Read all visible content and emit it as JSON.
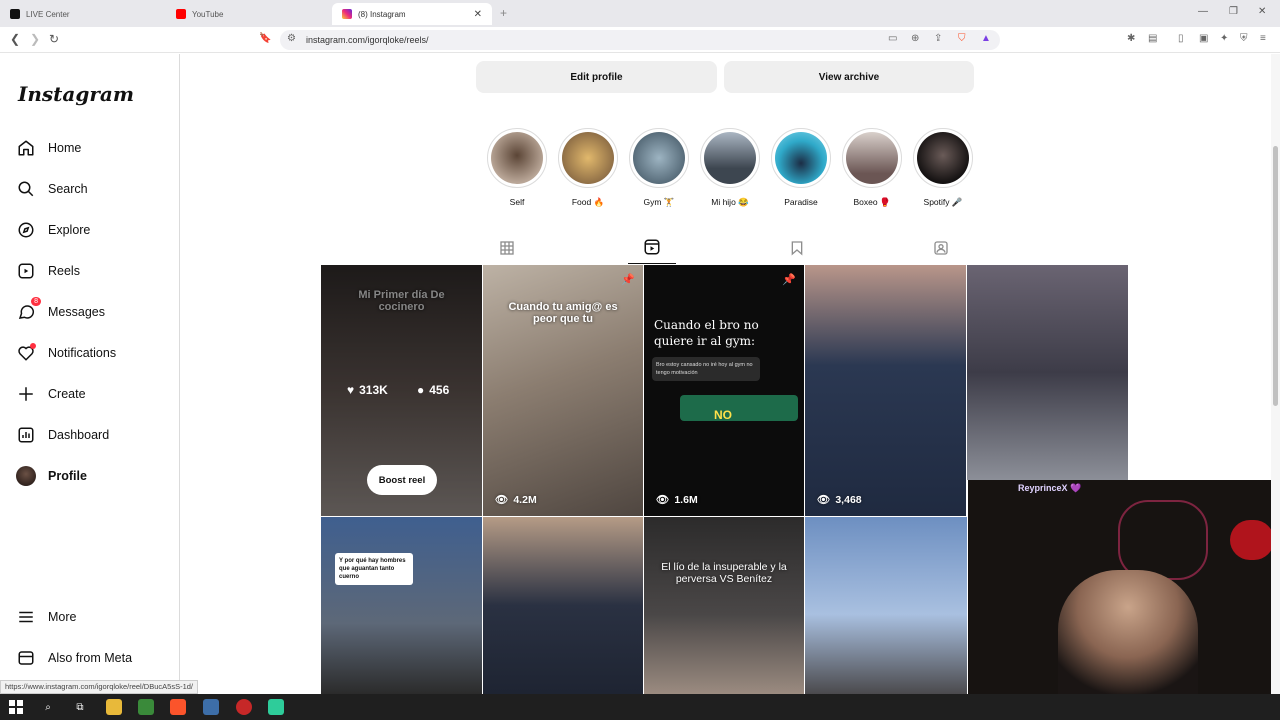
{
  "browser": {
    "tabs": [
      {
        "label": "LIVE Center",
        "icon": "tiktok-icon",
        "color": "#111111"
      },
      {
        "label": "YouTube",
        "icon": "youtube-icon",
        "color": "#ff0000"
      },
      {
        "label": "(8) Instagram",
        "icon": "instagram-icon",
        "color": "#e1306c"
      }
    ],
    "url": "instagram.com/igorqloke/reels/",
    "status_url": "https://www.instagram.com/igorqloke/reel/DBucA5sS-1d/"
  },
  "sidebar": {
    "logo": "Instagram",
    "items": [
      {
        "label": "Home",
        "icon": "home-icon"
      },
      {
        "label": "Search",
        "icon": "search-icon"
      },
      {
        "label": "Explore",
        "icon": "compass-icon"
      },
      {
        "label": "Reels",
        "icon": "reels-icon"
      },
      {
        "label": "Messages",
        "icon": "messenger-icon",
        "badge": "8"
      },
      {
        "label": "Notifications",
        "icon": "heart-icon"
      },
      {
        "label": "Create",
        "icon": "plus-icon"
      },
      {
        "label": "Dashboard",
        "icon": "dashboard-icon"
      },
      {
        "label": "Profile",
        "icon": "avatar"
      }
    ],
    "bottom": [
      {
        "label": "More",
        "icon": "menu-icon"
      },
      {
        "label": "Also from Meta",
        "icon": "meta-icon"
      }
    ]
  },
  "profile": {
    "edit_profile": "Edit profile",
    "view_archive": "View archive"
  },
  "highlights": [
    {
      "label": "Self",
      "color": "#b9a697"
    },
    {
      "label": "Food 🔥",
      "color": "#c59a5a"
    },
    {
      "label": "Gym 🏋",
      "color": "#7d96a6"
    },
    {
      "label": "Mi hijo 😂",
      "color": "#5d6874"
    },
    {
      "label": "Paradise",
      "color": "#2fa9c9"
    },
    {
      "label": "Boxeo 🥊",
      "color": "#8f7d7a"
    },
    {
      "label": "Spotify 🎤",
      "color": "#2a2424"
    }
  ],
  "profile_tabs": [
    "grid-icon",
    "reels-icon",
    "saved-icon",
    "tagged-icon"
  ],
  "reels": [
    {
      "caption": "Mi Primer día De cocinero",
      "likes": "313K",
      "comments": "456",
      "boost": "Boost reel",
      "bg": "#3b3534"
    },
    {
      "caption": "Cuando tu amig@ es peor que tu",
      "views": "4.2M",
      "pinned": true,
      "bg": "#8b7d70"
    },
    {
      "caption": "Cuando el bro no quiere ir al gym:",
      "chat": "Bro estoy cansado no iré hoy al gym no tengo motivación",
      "voice_label": "NO",
      "views": "1.6M",
      "pinned": true,
      "bg": "#0c0c0c"
    },
    {
      "views": "3,468",
      "bg": "#2b3852"
    },
    {
      "bg": "#3d3c48"
    },
    {
      "caption": "Y por qué hay hombres que aguantan tanto cuerno",
      "bg": "#5d6878"
    },
    {
      "bg": "#2a3142"
    },
    {
      "caption": "El lío de la insuperable y la perversa VS Benítez",
      "bg": "#4a4747"
    },
    {
      "bg": "#6d8fc1"
    }
  ],
  "webcam": {
    "name": "ReyprinceX 💜"
  }
}
